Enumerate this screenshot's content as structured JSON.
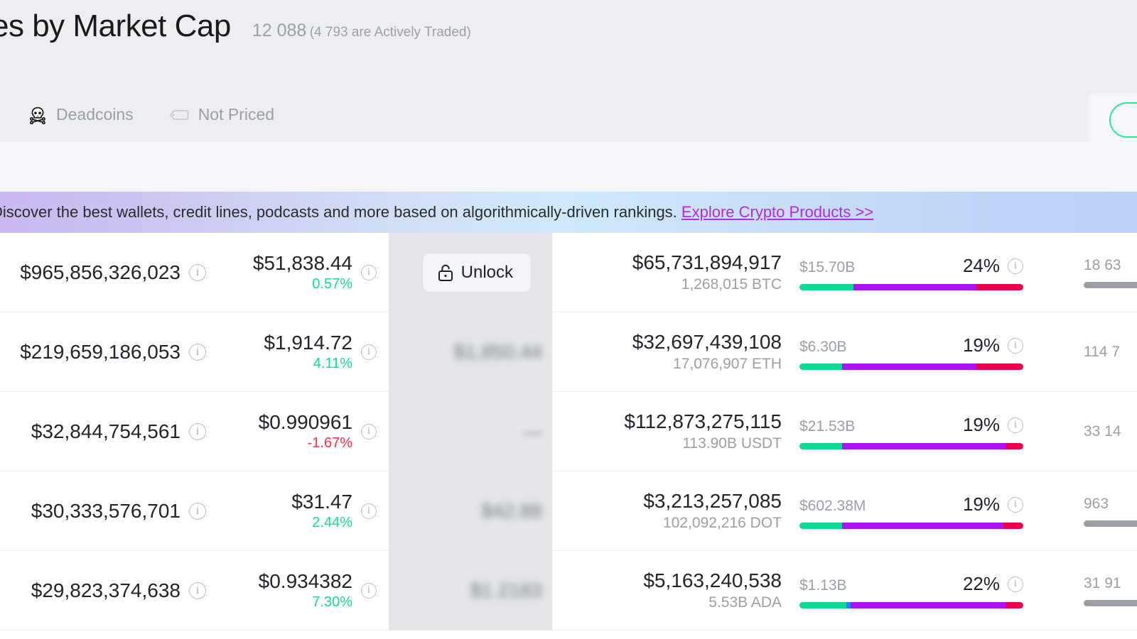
{
  "header": {
    "title": "es by Market Cap",
    "count_main": "12 088",
    "count_sub": "(4 793 are Actively Traded)",
    "filters": [
      {
        "label": "Deadcoins",
        "icon": "skull-icon"
      },
      {
        "label": "Not Priced",
        "icon": "tag-icon"
      }
    ]
  },
  "promo": {
    "text": "Discover the best wallets, credit lines, podcasts and more based on algorithmically-driven rankings. ",
    "link": "Explore Crypto Products >>",
    "link_color": "#b52ae0"
  },
  "colors": {
    "up": "#18d896",
    "down": "#ff2f48",
    "bar_green": "#0ed992",
    "bar_purple": "#ab14f2",
    "bar_red": "#e8064f",
    "bar_blue": "#2d7ff9",
    "accent_button_border": "#2ee39a"
  },
  "unlock_button_label": "Unlock",
  "info_glyph": "i",
  "rows": [
    {
      "market_cap": "$965,856,326,023",
      "price": "$51,838.44",
      "change": "0.57%",
      "change_dir": "up",
      "locked_type": "button",
      "locked_value": "",
      "volume": "$65,731,894,917",
      "volume_sub": "1,268,015 BTC",
      "liquidity_amount": "$15.70B",
      "liquidity_pct": "24%",
      "bar_segments": [
        {
          "color": "green",
          "pct": 24
        },
        {
          "color": "purple",
          "pct": 55
        },
        {
          "color": "red",
          "pct": 21
        }
      ],
      "right_value": "18 63",
      "right_has_bar": true
    },
    {
      "market_cap": "$219,659,186,053",
      "price": "$1,914.72",
      "change": "4.11%",
      "change_dir": "up",
      "locked_type": "blurred",
      "locked_value": "$1,850.44",
      "volume": "$32,697,439,108",
      "volume_sub": "17,076,907 ETH",
      "liquidity_amount": "$6.30B",
      "liquidity_pct": "19%",
      "bar_segments": [
        {
          "color": "green",
          "pct": 19
        },
        {
          "color": "purple",
          "pct": 60
        },
        {
          "color": "red",
          "pct": 21
        }
      ],
      "right_value": "114 7",
      "right_has_bar": false
    },
    {
      "market_cap": "$32,844,754,561",
      "price": "$0.990961",
      "change": "-1.67%",
      "change_dir": "down",
      "locked_type": "blurred-dash",
      "locked_value": "—",
      "volume": "$112,873,275,115",
      "volume_sub": "113.90B USDT",
      "liquidity_amount": "$21.53B",
      "liquidity_pct": "19%",
      "bar_segments": [
        {
          "color": "green",
          "pct": 19
        },
        {
          "color": "purple",
          "pct": 73
        },
        {
          "color": "red",
          "pct": 8
        }
      ],
      "right_value": "33 14",
      "right_has_bar": false
    },
    {
      "market_cap": "$30,333,576,701",
      "price": "$31.47",
      "change": "2.44%",
      "change_dir": "up",
      "locked_type": "blurred",
      "locked_value": "$42.88",
      "volume": "$3,213,257,085",
      "volume_sub": "102,092,216 DOT",
      "liquidity_amount": "$602.38M",
      "liquidity_pct": "19%",
      "bar_segments": [
        {
          "color": "green",
          "pct": 19
        },
        {
          "color": "purple",
          "pct": 72
        },
        {
          "color": "red",
          "pct": 9
        }
      ],
      "right_value": "963 ",
      "right_has_bar": true
    },
    {
      "market_cap": "$29,823,374,638",
      "price": "$0.934382",
      "change": "7.30%",
      "change_dir": "up",
      "locked_type": "blurred",
      "locked_value": "$1.2183",
      "volume": "$5,163,240,538",
      "volume_sub": "5.53B ADA",
      "liquidity_amount": "$1.13B",
      "liquidity_pct": "22%",
      "bar_segments": [
        {
          "color": "green",
          "pct": 21
        },
        {
          "color": "blue",
          "pct": 2
        },
        {
          "color": "purple",
          "pct": 69
        },
        {
          "color": "red",
          "pct": 8
        }
      ],
      "right_value": "31 91",
      "right_has_bar": true
    }
  ]
}
